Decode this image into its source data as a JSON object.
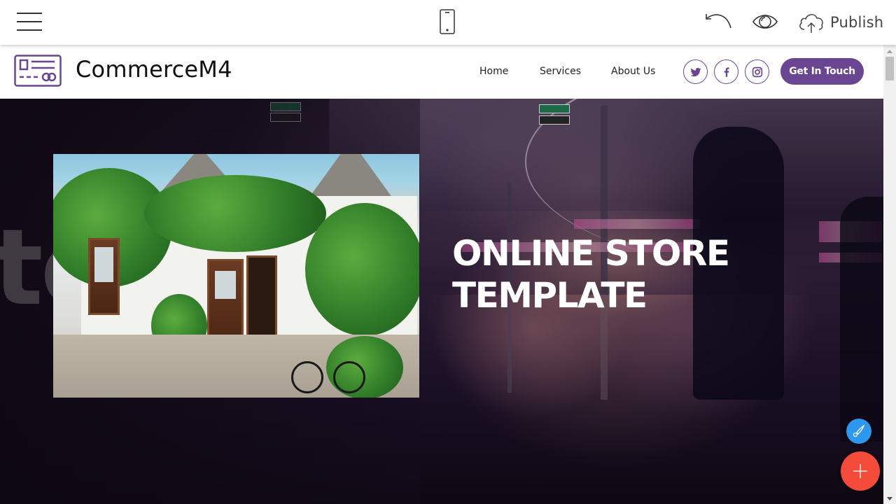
{
  "editor_toolbar": {
    "menu_icon": "hamburger-menu-icon",
    "device_icon": "mobile-phone-icon",
    "undo_icon": "undo-icon",
    "preview_icon": "eye-icon",
    "publish_icon": "cloud-upload-icon",
    "publish_label": "Publish"
  },
  "site_nav": {
    "brand_name": "CommerceM4",
    "brand_logo": "credit-card-logo-icon",
    "links": [
      {
        "label": "Home"
      },
      {
        "label": "Services"
      },
      {
        "label": "About Us"
      }
    ],
    "social": [
      {
        "name": "twitter",
        "icon": "twitter-icon"
      },
      {
        "name": "facebook",
        "icon": "facebook-icon"
      },
      {
        "name": "instagram",
        "icon": "instagram-icon"
      }
    ],
    "cta_label": "Get In Touch",
    "accent_color": "#6a4592"
  },
  "hero": {
    "title": "ONLINE STORE TEMPLATE",
    "background_word": "to",
    "photo_description": "white house with green vines and bicycle"
  },
  "fabs": {
    "edit_icon": "brush-icon",
    "edit_color": "#2e97ee",
    "add_icon": "plus-icon",
    "add_color": "#f44b3b"
  }
}
